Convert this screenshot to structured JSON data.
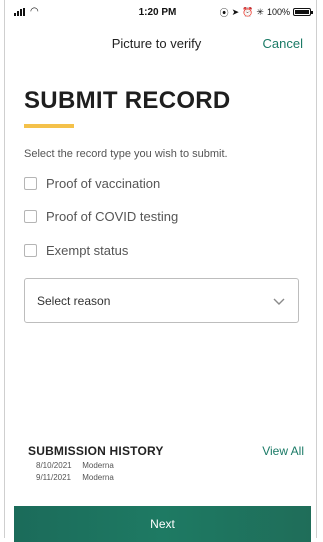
{
  "status_bar": {
    "time": "1:20 PM",
    "battery": "100%",
    "icons": [
      "signal-icon",
      "wifi-icon",
      "location-icon",
      "alarm-icon",
      "bluetooth-icon",
      "battery-icon"
    ]
  },
  "nav": {
    "title": "Picture to verify",
    "cancel_label": "Cancel"
  },
  "page": {
    "title": "SUBMIT RECORD",
    "instruction": "Select the record type you wish to submit."
  },
  "record_types": [
    {
      "label": "Proof of vaccination",
      "checked": false
    },
    {
      "label": "Proof of COVID testing",
      "checked": false
    },
    {
      "label": "Exempt status",
      "checked": false
    }
  ],
  "reason_select": {
    "value": "Select reason"
  },
  "history": {
    "title": "SUBMISSION HISTORY",
    "view_all_label": "View All",
    "items": [
      {
        "date": "8/10/2021",
        "vaccine": "Moderna"
      },
      {
        "date": "9/11/2021",
        "vaccine": "Moderna"
      }
    ]
  },
  "footer": {
    "next_label": "Next"
  },
  "colors": {
    "accent": "#1a7a66",
    "underline": "#f4c14a",
    "button": "#1e7a63"
  }
}
